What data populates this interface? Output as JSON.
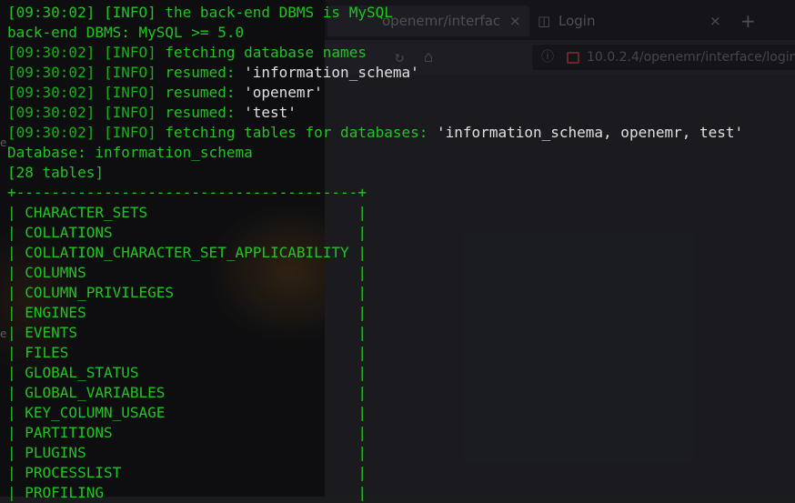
{
  "browser": {
    "tabs": [
      {
        "title": "openemr/interfac",
        "close": "×"
      },
      {
        "title": "Login",
        "close": "×"
      }
    ],
    "new_tab_label": "+",
    "url": "10.0.2.4/openemr/interface/login"
  },
  "terminal": {
    "lines": [
      {
        "time": "[09:30:02]",
        "level": "[INFO]",
        "text": " the back-end DBMS is MySQL"
      },
      {
        "raw": "back-end DBMS: MySQL >= 5.0"
      },
      {
        "time": "[09:30:02]",
        "level": "[INFO]",
        "text": " fetching database names"
      },
      {
        "time": "[09:30:02]",
        "level": "[INFO]",
        "text": " resumed: ",
        "value": "'information_schema'"
      },
      {
        "time": "[09:30:02]",
        "level": "[INFO]",
        "text": " resumed: ",
        "value": "'openemr'"
      },
      {
        "time": "[09:30:02]",
        "level": "[INFO]",
        "text": " resumed: ",
        "value": "'test'"
      },
      {
        "time": "[09:30:02]",
        "level": "[INFO]",
        "text": " fetching tables for databases: ",
        "value": "'information_schema, openemr, test'"
      },
      {
        "raw": "Database: information_schema"
      },
      {
        "raw": "[28 tables]"
      }
    ],
    "table_border": "+---------------------------------------+",
    "tables": [
      "CHARACTER_SETS",
      "COLLATIONS",
      "COLLATION_CHARACTER_SET_APPLICABILITY",
      "COLUMNS",
      "COLUMN_PRIVILEGES",
      "ENGINES",
      "EVENTS",
      "FILES",
      "GLOBAL_STATUS",
      "GLOBAL_VARIABLES",
      "KEY_COLUMN_USAGE",
      "PARTITIONS",
      "PLUGINS",
      "PROCESSLIST",
      "PROFILING"
    ],
    "table_inner_width": 39
  },
  "colors": {
    "terminal_green": "#21c421",
    "value_white": "#e0e0e0"
  }
}
